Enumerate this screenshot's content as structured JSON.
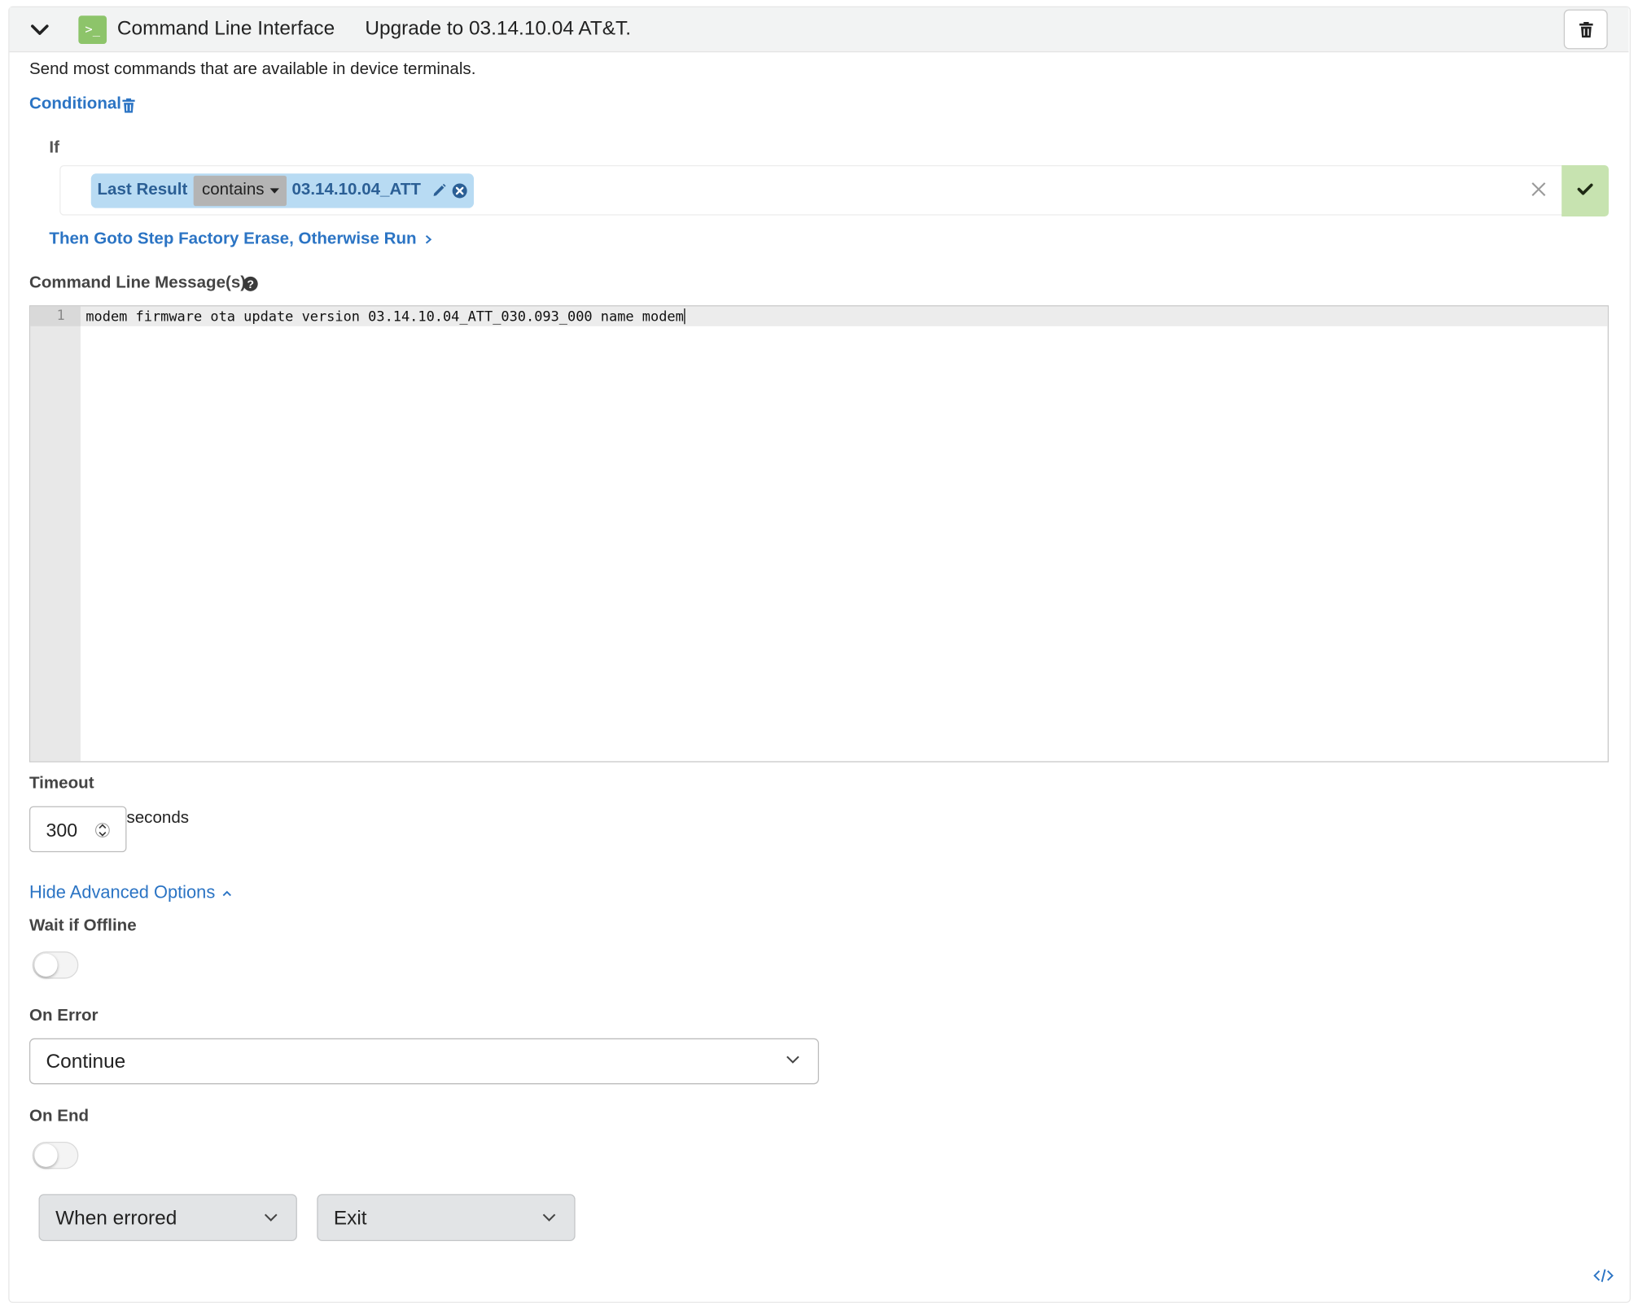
{
  "header": {
    "title": "Command Line Interface",
    "step_name": "Upgrade to 03.14.10.04 AT&T.",
    "icon_glyph": ">_",
    "icon_color": "#8dc46a"
  },
  "description": "Send most commands that are available in device terminals.",
  "conditional": {
    "label": "Conditional",
    "if_label": "If",
    "field": "Last Result",
    "operator": "contains",
    "value": "03.14.10.04_ATT",
    "then_text": "Then Goto Step Factory Erase, Otherwise Run",
    "chip_color": "#b8dbf3",
    "confirm_color": "#c7e3b0"
  },
  "commands": {
    "label": "Command Line Message(s)",
    "lines": [
      {
        "number": "1",
        "text": "modem firmware ota update version 03.14.10.04_ATT_030.093_000 name modem"
      }
    ]
  },
  "timeout": {
    "label": "Timeout",
    "value": "300",
    "unit": "seconds"
  },
  "advanced": {
    "toggle_label": "Hide Advanced Options",
    "wait_if_offline": {
      "label": "Wait if Offline",
      "enabled": false
    },
    "on_error": {
      "label": "On Error",
      "selected": "Continue"
    },
    "on_end": {
      "label": "On End",
      "enabled": false,
      "condition_selected": "When errored",
      "action_selected": "Exit"
    }
  },
  "colors": {
    "link": "#2b74c4",
    "header_bg": "#f2f3f3"
  }
}
